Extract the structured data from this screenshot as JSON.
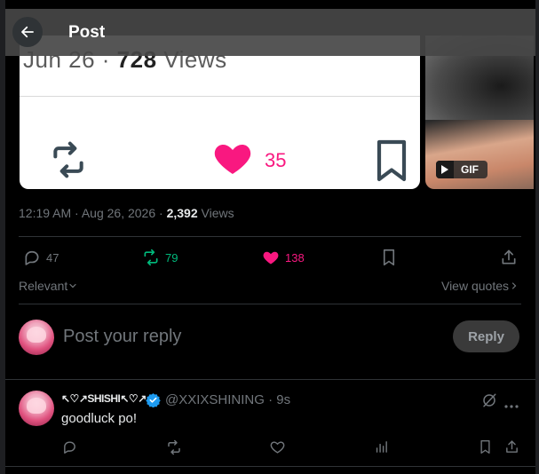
{
  "header": {
    "title": "Post"
  },
  "embedded": {
    "date_text": "Jun 26 · ",
    "views_count": "728",
    "views_label": " Views",
    "like_count": "35"
  },
  "gif": {
    "label": "GIF"
  },
  "post": {
    "time": "12:19 AM",
    "dot1": " · ",
    "date": "Aug 26, 2026",
    "dot2": " · ",
    "views_count": "2,392",
    "views_label": " Views"
  },
  "actions": {
    "replies": "47",
    "reposts": "79",
    "likes": "138"
  },
  "filters": {
    "sort": "Relevant",
    "view_quotes": "View quotes"
  },
  "composer": {
    "placeholder": "Post your reply",
    "button": "Reply"
  },
  "reply": {
    "display_name": "↖♡↗SHISHI↖♡↗",
    "handle": "@XXIXSHINING",
    "time": "9s",
    "text": "goodluck po!"
  },
  "colors": {
    "like": "#f91880",
    "repost": "#00ba7c",
    "verified": "#1d9bf0",
    "muted": "#71767b"
  }
}
